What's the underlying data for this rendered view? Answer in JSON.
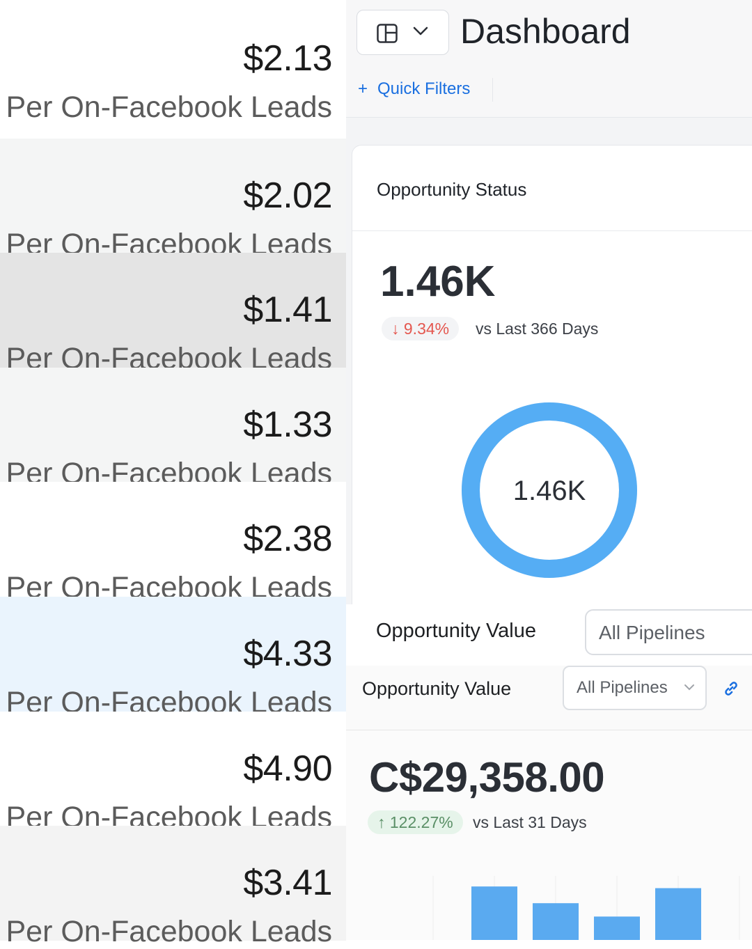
{
  "cost_per_lead": [
    {
      "price": "$2.13",
      "label": "Per On-Facebook Leads",
      "bg": "#ffffff"
    },
    {
      "price": "$2.02",
      "label": "Per On-Facebook Leads",
      "bg": "#f4f5f5"
    },
    {
      "price": "$1.41",
      "label": "Per On-Facebook Leads",
      "bg": "#e4e4e4"
    },
    {
      "price": "$1.33",
      "label": "Per On-Facebook Leads",
      "bg": "#f4f5f5"
    },
    {
      "price": "$2.38",
      "label": "Per On-Facebook Leads",
      "bg": "#ffffff"
    },
    {
      "price": "$4.33",
      "label": "Per On-Facebook Leads",
      "bg": "#eaf4fd"
    },
    {
      "price": "$4.90",
      "label": "Per On-Facebook Leads",
      "bg": "#ffffff"
    },
    {
      "price": "$3.41",
      "label": "Per On-Facebook Leads",
      "bg": "#f3f3f3"
    }
  ],
  "header": {
    "title": "Dashboard",
    "quick_filters_label": "Quick Filters",
    "quick_filters_icon": "plus-icon",
    "layout_icon": "layout-grid-icon",
    "accent_color": "#1a6fe0"
  },
  "opportunity_status": {
    "title": "Opportunity Status",
    "value": "1.46K",
    "delta": "9.34%",
    "delta_direction": "down",
    "delta_color": "#e4574f",
    "comparison": "vs Last 366 Days",
    "donut_center": "1.46K",
    "donut_fraction": 1.0,
    "donut_color": "#55adf4"
  },
  "opportunity_value": {
    "title": "Opportunity Value",
    "pipeline_select": "All Pipelines",
    "title_secondary": "Opportunity Value",
    "pipeline_select_secondary": "All Pipelines",
    "amount": "C$29,358.00",
    "delta": "122.27%",
    "delta_direction": "up",
    "delta_color": "#5a8f66",
    "comparison": "vs Last 31 Days",
    "bar_color": "#5aaaf0"
  },
  "chart_data": {
    "type": "bar",
    "categories": [
      "",
      "",
      "",
      "",
      ""
    ],
    "values": [
      0,
      64,
      44,
      28,
      62
    ],
    "title": "",
    "xlabel": "",
    "ylabel": "",
    "ylim": [
      0,
      100
    ],
    "grid": true
  }
}
